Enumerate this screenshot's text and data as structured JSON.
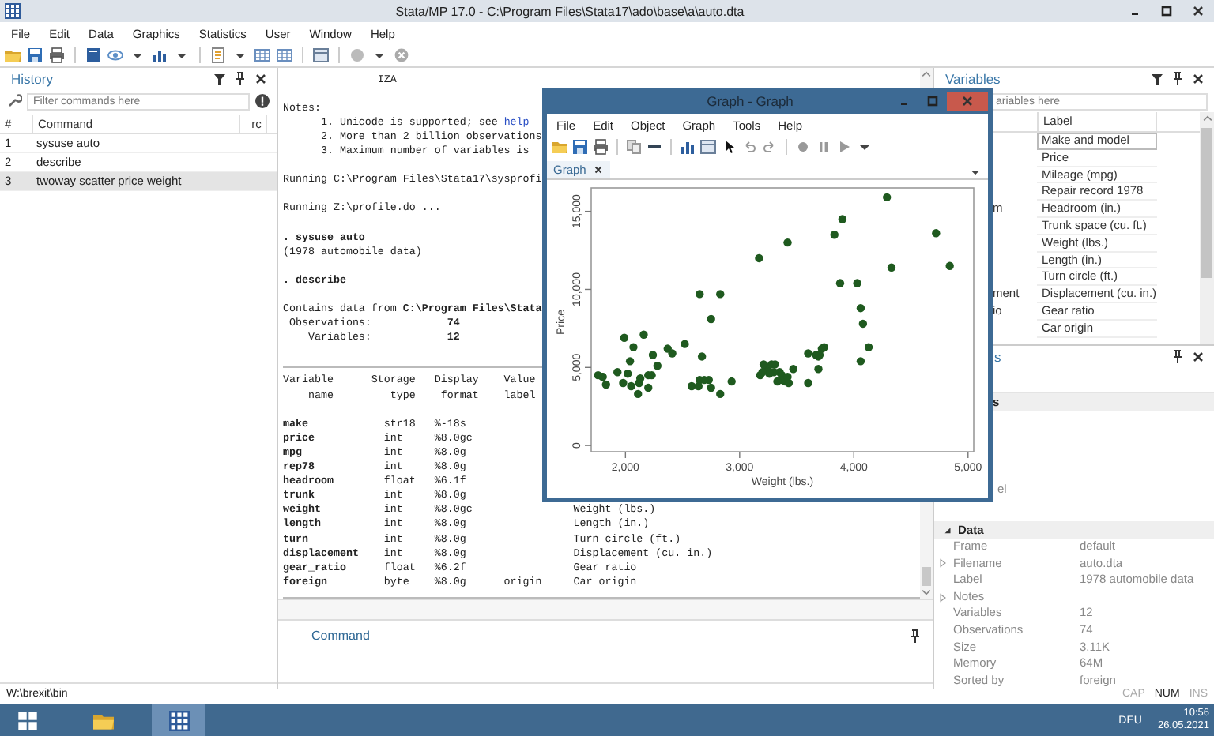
{
  "window": {
    "title": "Stata/MP 17.0 - C:\\Program Files\\Stata17\\ado\\base\\a\\auto.dta"
  },
  "menu": [
    "File",
    "Edit",
    "Data",
    "Graphics",
    "Statistics",
    "User",
    "Window",
    "Help"
  ],
  "history": {
    "title": "History",
    "filter": {
      "placeholder": "Filter commands here"
    },
    "columns": [
      "#",
      "Command",
      "_rc"
    ],
    "rows": [
      {
        "number": "1",
        "command": "sysuse auto",
        "selected": false
      },
      {
        "number": "2",
        "command": "describe",
        "selected": false
      },
      {
        "number": "3",
        "command": "twoway scatter price weight",
        "selected": true
      }
    ]
  },
  "results": {
    "lines": [
      {
        "kind": "text",
        "text": "               IZA"
      },
      {
        "kind": "blank"
      },
      {
        "kind": "text",
        "text": "Notes:"
      },
      {
        "kind": "text",
        "text": "      1. Unicode is supported; see ",
        "link": "help"
      },
      {
        "kind": "text",
        "text": "      2. More than 2 billion observations"
      },
      {
        "kind": "text",
        "text": "      3. Maximum number of variables is"
      },
      {
        "kind": "blank"
      },
      {
        "kind": "text",
        "text": "Running C:\\Program Files\\Stata17\\sysprofi"
      },
      {
        "kind": "blank"
      },
      {
        "kind": "text",
        "text": "Running Z:\\profile.do ..."
      },
      {
        "kind": "blank"
      },
      {
        "kind": "command",
        "text": ". sysuse auto"
      },
      {
        "kind": "text",
        "text": "(1978 automobile data)"
      },
      {
        "kind": "blank"
      },
      {
        "kind": "command",
        "text": ". describe"
      },
      {
        "kind": "blank"
      },
      {
        "kind": "text",
        "text": "Contains data from **C:\\Program Files\\Stata**"
      },
      {
        "kind": "text",
        "text": " Observations:            **74**"
      },
      {
        "kind": "text",
        "text": "    Variables:            **12**"
      },
      {
        "kind": "blank"
      },
      {
        "kind": "rule"
      },
      {
        "kind": "text",
        "text": "Variable      Storage   Display    Value"
      },
      {
        "kind": "text",
        "text": "    name         type    format    label"
      },
      {
        "kind": "blank"
      },
      {
        "kind": "var",
        "name": "make",
        "type": "str18",
        "format": "%-18s"
      },
      {
        "kind": "var",
        "name": "price",
        "type": "int",
        "format": "%8.0gc"
      },
      {
        "kind": "var",
        "name": "mpg",
        "type": "int",
        "format": "%8.0g"
      },
      {
        "kind": "var",
        "name": "rep78",
        "type": "int",
        "format": "%8.0g"
      },
      {
        "kind": "var",
        "name": "headroom",
        "type": "float",
        "format": "%6.1f"
      },
      {
        "kind": "var",
        "name": "trunk",
        "type": "int",
        "format": "%8.0g"
      },
      {
        "kind": "var",
        "name": "weight",
        "type": "int",
        "format": "%8.0gc",
        "label": "Weight (lbs.)"
      },
      {
        "kind": "var",
        "name": "length",
        "type": "int",
        "format": "%8.0g",
        "label": "Length (in.)"
      },
      {
        "kind": "var",
        "name": "turn",
        "type": "int",
        "format": "%8.0g",
        "label": "Turn circle (ft.)"
      },
      {
        "kind": "var",
        "name": "displacement",
        "type": "int",
        "format": "%8.0g",
        "label": "Displacement (cu. in.)"
      },
      {
        "kind": "var",
        "name": "gear_ratio",
        "type": "float",
        "format": "%6.2f",
        "label": "Gear ratio"
      },
      {
        "kind": "var",
        "name": "foreign",
        "type": "byte",
        "format": "%8.0g",
        "value_label": "origin",
        "label": "Car origin"
      },
      {
        "kind": "rule"
      }
    ]
  },
  "command": {
    "title": "Command"
  },
  "variables": {
    "title": "Variables",
    "filter": {
      "placeholder": "ariables here"
    },
    "columns": [
      "Label"
    ],
    "rows": [
      {
        "label": "Make and model",
        "selected": true
      },
      {
        "label": "Price",
        "selected": false
      },
      {
        "label": "Mileage (mpg)",
        "selected": false
      },
      {
        "label": "Repair record 1978",
        "selected": false
      },
      {
        "name": "m",
        "label": "Headroom (in.)",
        "selected": false
      },
      {
        "label": "Trunk space (cu. ft.)",
        "selected": false
      },
      {
        "label": "Weight (lbs.)",
        "selected": false
      },
      {
        "label": "Length (in.)",
        "selected": false
      },
      {
        "label": "Turn circle (ft.)",
        "selected": false
      },
      {
        "name": "ment",
        "label": "Displacement (cu. in.)",
        "selected": false
      },
      {
        "name": "io",
        "label": "Gear ratio",
        "selected": false
      },
      {
        "label": "Car origin",
        "selected": false
      }
    ]
  },
  "properties": {
    "title": "s",
    "sections": [
      {
        "title": "s",
        "rows": [
          {
            "label": "el",
            "collapsed": false
          }
        ]
      },
      {
        "title": "Data",
        "expanded": true,
        "rows": [
          {
            "label": "Frame",
            "value": "default",
            "collapsed": false
          },
          {
            "label": "Filename",
            "value": "auto.dta",
            "collapsed": true
          },
          {
            "label": "Label",
            "value": "1978 automobile data",
            "collapsed": false
          },
          {
            "label": "Notes",
            "collapsed": true
          },
          {
            "label": "Variables",
            "value": "12",
            "collapsed": false
          },
          {
            "label": "Observations",
            "value": "74",
            "collapsed": false
          },
          {
            "label": "Size",
            "value": "3.11K",
            "collapsed": false
          },
          {
            "label": "Memory",
            "value": "64M",
            "collapsed": false
          },
          {
            "label": "Sorted by",
            "value": "foreign",
            "collapsed": false
          }
        ]
      }
    ]
  },
  "graph_window": {
    "title": "Graph - Graph",
    "menu": [
      "File",
      "Edit",
      "Object",
      "Graph",
      "Tools",
      "Help"
    ],
    "tabs": [
      {
        "label": "Graph",
        "selected": true
      }
    ],
    "chart_data": {
      "type": "scatter",
      "xlabel": "Weight (lbs.)",
      "ylabel": "Price",
      "x": [
        2930,
        3350,
        2640,
        3250,
        4080,
        3670,
        2230,
        3280,
        3880,
        3400,
        4330,
        3900,
        4290,
        2110,
        3690,
        3180,
        3220,
        2750,
        3430,
        2120,
        3600,
        3600,
        3740,
        1800,
        2650,
        4840,
        4720,
        3830,
        2580,
        4060,
        3720,
        3370,
        4130,
        2830,
        4060,
        3310,
        3300,
        3690,
        3370,
        2730,
        4030,
        3260,
        1800,
        2200,
        2520,
        3330,
        3700,
        3470,
        3210,
        3200,
        3420,
        2690,
        2830,
        2070,
        2650,
        2370,
        2020,
        2280,
        2750,
        2240,
        1760,
        1980,
        3420,
        1830,
        2050,
        2410,
        2200,
        2670,
        2160,
        2040,
        1930,
        1990,
        3170,
        2130
      ],
      "series": [
        {
          "color": "#1f5a1f",
          "values": [
            4100,
            4700,
            3800,
            4800,
            7800,
            5800,
            4500,
            5200,
            10400,
            4100,
            11400,
            14500,
            15900,
            3300,
            5700,
            4500,
            5100,
            3700,
            4000,
            4000,
            4000,
            5900,
            6300,
            4400,
            4200,
            11500,
            13600,
            13500,
            3800,
            5400,
            6200,
            4500,
            6300,
            3300,
            8800,
            5200,
            4700,
            4900,
            4200,
            4200,
            10400,
            4600,
            4400,
            4500,
            6500,
            4100,
            5800,
            4900,
            5200,
            4700,
            4400,
            4200,
            9700,
            6300,
            9700,
            6200,
            4600,
            5100,
            8100,
            5800,
            4500,
            4000,
            13000,
            3900,
            3800,
            5900,
            3700,
            5700,
            7100,
            5400,
            4700,
            6900,
            12000,
            4300
          ]
        }
      ],
      "xlim": [
        1700,
        5050
      ],
      "ylim": [
        -400,
        16500
      ],
      "xticks": [
        {
          "value": 2000,
          "label": "2,000"
        },
        {
          "value": 3000,
          "label": "3,000"
        },
        {
          "value": 4000,
          "label": "4,000"
        },
        {
          "value": 5000,
          "label": "5,000"
        }
      ],
      "yticks": [
        {
          "value": 0,
          "label": "0"
        },
        {
          "value": 5000,
          "label": "5,000"
        },
        {
          "value": 10000,
          "label": "10,000"
        },
        {
          "value": 15000,
          "label": "15,000"
        }
      ]
    }
  },
  "status_bar": {
    "path": "W:\\brexit\\bin",
    "indicators": [
      {
        "label": "CAP",
        "on": false
      },
      {
        "label": "NUM",
        "on": true
      },
      {
        "label": "INS",
        "on": false
      }
    ]
  },
  "taskbar": {
    "apps": [
      {
        "kind": "start",
        "selected": false
      },
      {
        "kind": "folder",
        "selected": false
      },
      {
        "kind": "stata",
        "selected": true
      }
    ],
    "language": "DEU",
    "time": "10:56",
    "date": "26.05.2021"
  }
}
